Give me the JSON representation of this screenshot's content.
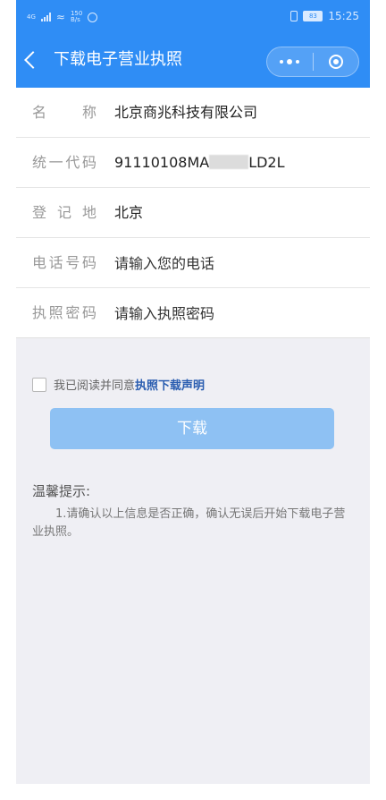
{
  "status_bar": {
    "signal": "4G",
    "net_speed_value": "150",
    "net_speed_unit": "B/s",
    "battery": "83",
    "time": "15:25"
  },
  "nav": {
    "title": "下载电子营业执照",
    "icons": [
      "back-icon",
      "more-icon",
      "close-miniprogram-icon"
    ]
  },
  "form": {
    "name_label": "名 称",
    "name_value": "北京商兆科技有限公司",
    "code_label": "统一代码",
    "code_prefix": "91110108MA",
    "code_suffix": "LD2L",
    "region_label": "登 记 地",
    "region_value": "北京",
    "phone_label": "电话号码",
    "phone_placeholder": "请输入您的电话",
    "password_label": "执照密码",
    "password_placeholder": "请输入执照密码"
  },
  "agreement": {
    "text": "我已阅读并同意",
    "link": "执照下载声明",
    "checked": false
  },
  "download_button": "下载",
  "tips": {
    "title": "温馨提示:",
    "text": "1.请确认以上信息是否正确，确认无误后开始下载电子营业执照。"
  },
  "colors": {
    "primary": "#2f8df5",
    "button_disabled": "#8ec1f3",
    "link": "#2a5db0",
    "background": "#efeff4"
  }
}
